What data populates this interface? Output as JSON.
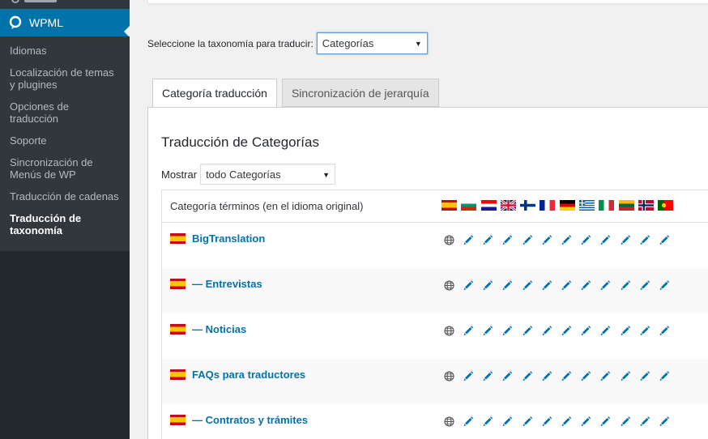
{
  "sidebar": {
    "plugin_name": "WPML",
    "items": [
      {
        "label": "Idiomas",
        "active": false
      },
      {
        "label": "Localización de temas y plugines",
        "active": false
      },
      {
        "label": "Opciones de traducción",
        "active": false
      },
      {
        "label": "Soporte",
        "active": false
      },
      {
        "label": "Sincronización de Menús de WP",
        "active": false
      },
      {
        "label": "Traducción de cadenas",
        "active": false
      },
      {
        "label": "Traducción de taxonomía",
        "active": true
      }
    ]
  },
  "taxonomy": {
    "label": "Seleccione la taxonomía para traducir:",
    "selected": "Categorías"
  },
  "tabs": [
    {
      "label": "Categoría traducción",
      "active": true
    },
    {
      "label": "Sincronización de jerarquía",
      "active": false
    }
  ],
  "panel": {
    "title": "Traducción de Categorías",
    "show_label": "Mostrar",
    "show_selected": "todo Categorías"
  },
  "table": {
    "header": "Categoría términos (en el idioma original)",
    "language_flags": [
      "es",
      "bg",
      "hr",
      "gb",
      "fi",
      "fr",
      "de",
      "gr",
      "it",
      "lt",
      "no",
      "pt"
    ],
    "rows": [
      {
        "flag": "es",
        "name": "BigTranslation"
      },
      {
        "flag": "es",
        "name": "— Entrevistas"
      },
      {
        "flag": "es",
        "name": "— Noticias"
      },
      {
        "flag": "es",
        "name": "FAQs para traductores"
      },
      {
        "flag": "es",
        "name": "— Contratos y trámites"
      }
    ]
  },
  "colors": {
    "sidebar_bg": "#23282d",
    "submenu_bg": "#32373c",
    "accent": "#0073aa"
  }
}
